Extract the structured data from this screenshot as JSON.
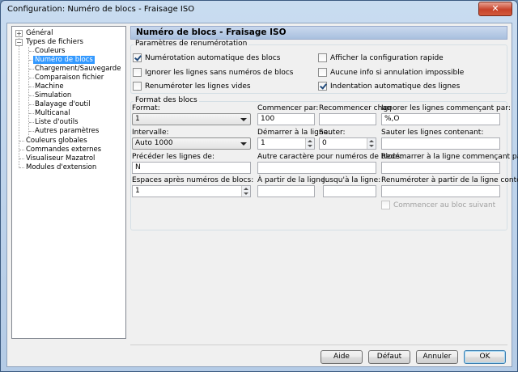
{
  "window": {
    "title": "Configuration: Numéro de blocs - Fraisage ISO",
    "close_glyph": "✕"
  },
  "tree": {
    "items": [
      {
        "label": "Général",
        "expander": "+"
      },
      {
        "label": "Types de fichiers",
        "expander": "−"
      },
      {
        "label": "Couleurs"
      },
      {
        "label": "Numéro de blocs"
      },
      {
        "label": "Chargement/Sauvegarde"
      },
      {
        "label": "Comparaison fichier"
      },
      {
        "label": "Machine"
      },
      {
        "label": "Simulation"
      },
      {
        "label": "Balayage d'outil"
      },
      {
        "label": "Multicanal"
      },
      {
        "label": "Liste d'outils"
      },
      {
        "label": "Autres paramètres"
      },
      {
        "label": "Couleurs globales"
      },
      {
        "label": "Commandes externes"
      },
      {
        "label": "Visualiseur Mazatrol"
      },
      {
        "label": "Modules d'extension"
      }
    ]
  },
  "panel": {
    "title": "Numéro de blocs - Fraisage ISO"
  },
  "renumber_group": {
    "label": "Paramètres de renumérotation",
    "auto_renumber": {
      "label": "Numérotation automatique des blocs",
      "checked": true
    },
    "ignore_no_number": {
      "label": "Ignorer les lignes sans numéros de blocs",
      "checked": false
    },
    "renumber_empty": {
      "label": "Renuméroter les lignes vides",
      "checked": false
    },
    "show_quick_config": {
      "label": "Afficher la configuration rapide",
      "checked": false
    },
    "no_info_undo": {
      "label": "Aucune info si annulation impossible",
      "checked": false
    },
    "auto_indent": {
      "label": "Indentation automatique des lignes",
      "checked": true
    }
  },
  "format_group": {
    "label": "Format des blocs",
    "format_label": "Format:",
    "format_value": "1",
    "start_label": "Commencer par:",
    "start_value": "100",
    "restart_each_label": "Recommencer chaq",
    "restart_each_value": "",
    "ignore_starting_label": "Ignorer les lignes commençant par:",
    "ignore_starting_value": "%,O",
    "interval_label": "Intervalle:",
    "interval_value": "Auto 1000",
    "start_line_label": "Démarrer à la ligne:",
    "start_line_value": "1",
    "skip_label": "Sauter:",
    "skip_value": "0",
    "skip_containing_label": "Sauter les lignes contenant:",
    "skip_containing_value": "",
    "prefix_label": "Précéder les lignes de:",
    "prefix_value": "N",
    "other_char_label": "Autre caractère pour numéros de blocs:",
    "other_char_value": "",
    "restart_starting_label": "Redémarrer à la ligne commençant par:",
    "restart_starting_value": "",
    "spaces_label": "Espaces après numéros de blocs:",
    "spaces_value": "1",
    "from_line_label": "À partir de la ligne:",
    "from_line_value": "",
    "to_line_label": "Jusqu'à la ligne:",
    "to_line_value": "",
    "renumber_from_containing_label": "Renuméroter à partir de la ligne contenant:",
    "renumber_from_containing_value": "",
    "continue_next_block": {
      "label": "Commencer au bloc suivant",
      "checked": false
    }
  },
  "buttons": {
    "help": "Aide",
    "default": "Défaut",
    "cancel": "Annuler",
    "ok": "OK"
  }
}
